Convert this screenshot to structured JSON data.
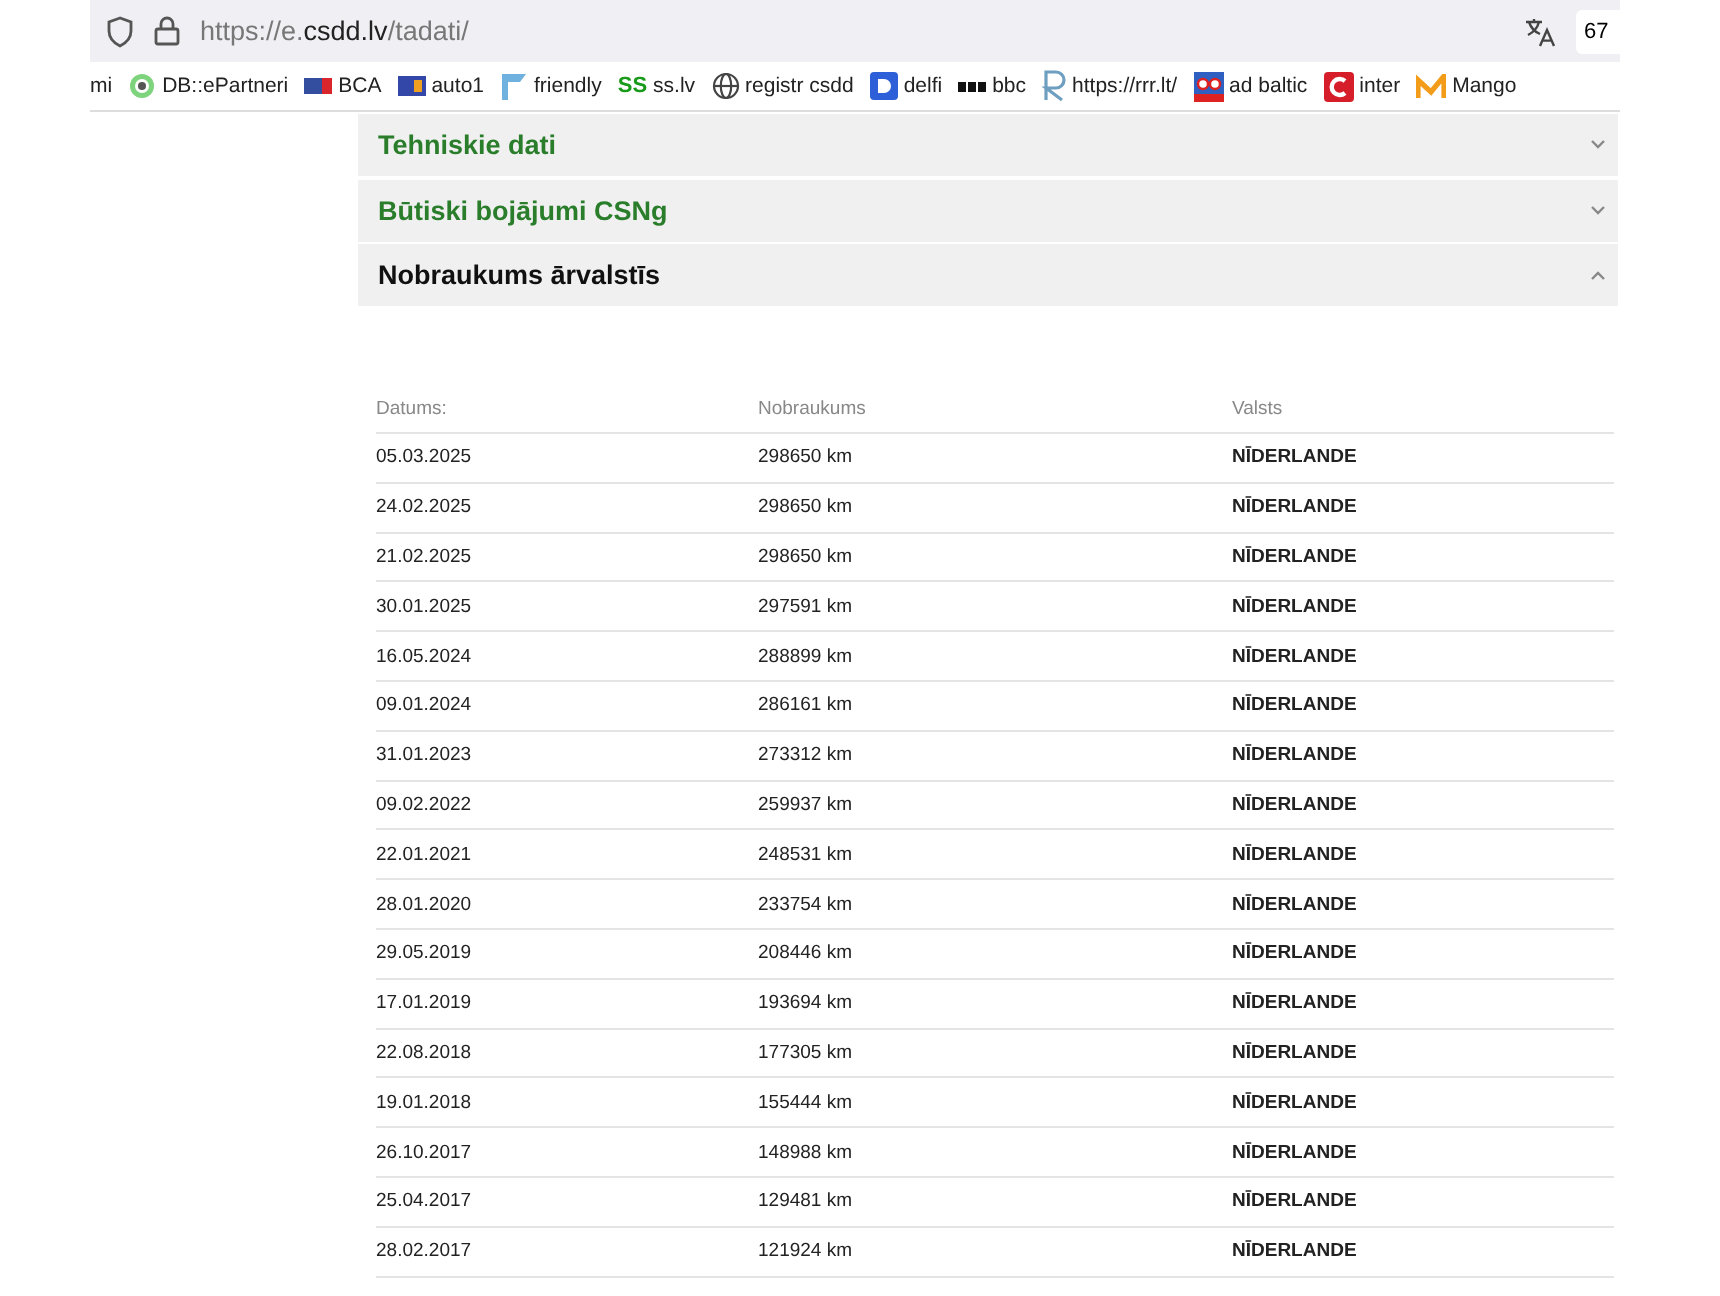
{
  "browser": {
    "url_prefix": "https://e.",
    "url_domain": "csdd.lv",
    "url_path": "/tadati/",
    "zoom": "67"
  },
  "bookmarks": [
    {
      "label": "mi",
      "kind": "none"
    },
    {
      "label": "DB::ePartneri",
      "kind": "ring"
    },
    {
      "label": "BCA",
      "kind": "flag"
    },
    {
      "label": "auto1",
      "kind": "tile"
    },
    {
      "label": "friendly",
      "kind": "banner"
    },
    {
      "label": "ss.lv",
      "kind": "ss",
      "icon_text": "SS"
    },
    {
      "label": "registr csdd",
      "kind": "globe"
    },
    {
      "label": "delfi",
      "kind": "d"
    },
    {
      "label": "bbc",
      "kind": "dots"
    },
    {
      "label": "https://rrr.lt/",
      "kind": "r"
    },
    {
      "label": "ad baltic",
      "kind": "badge"
    },
    {
      "label": "inter",
      "kind": "redtile"
    },
    {
      "label": "Mango",
      "kind": "m"
    }
  ],
  "sections": [
    {
      "title": "Tehniskie dati",
      "expanded": false
    },
    {
      "title": "Būtiski bojājumi CSNg",
      "expanded": false
    },
    {
      "title": "Nobraukums ārvalstīs",
      "expanded": true
    }
  ],
  "table": {
    "columns": [
      "Datums:",
      "Nobraukums",
      "Valsts"
    ],
    "rows": [
      [
        "05.03.2025",
        "298650 km",
        "NĪDERLANDE"
      ],
      [
        "24.02.2025",
        "298650 km",
        "NĪDERLANDE"
      ],
      [
        "21.02.2025",
        "298650 km",
        "NĪDERLANDE"
      ],
      [
        "30.01.2025",
        "297591 km",
        "NĪDERLANDE"
      ],
      [
        "16.05.2024",
        "288899 km",
        "NĪDERLANDE"
      ],
      [
        "09.01.2024",
        "286161 km",
        "NĪDERLANDE"
      ],
      [
        "31.01.2023",
        "273312 km",
        "NĪDERLANDE"
      ],
      [
        "09.02.2022",
        "259937 km",
        "NĪDERLANDE"
      ],
      [
        "22.01.2021",
        "248531 km",
        "NĪDERLANDE"
      ],
      [
        "28.01.2020",
        "233754 km",
        "NĪDERLANDE"
      ],
      [
        "29.05.2019",
        "208446 km",
        "NĪDERLANDE"
      ],
      [
        "17.01.2019",
        "193694 km",
        "NĪDERLANDE"
      ],
      [
        "22.08.2018",
        "177305 km",
        "NĪDERLANDE"
      ],
      [
        "19.01.2018",
        "155444 km",
        "NĪDERLANDE"
      ],
      [
        "26.10.2017",
        "148988 km",
        "NĪDERLANDE"
      ],
      [
        "25.04.2017",
        "129481 km",
        "NĪDERLANDE"
      ],
      [
        "28.02.2017",
        "121924 km",
        "NĪDERLANDE"
      ]
    ]
  }
}
